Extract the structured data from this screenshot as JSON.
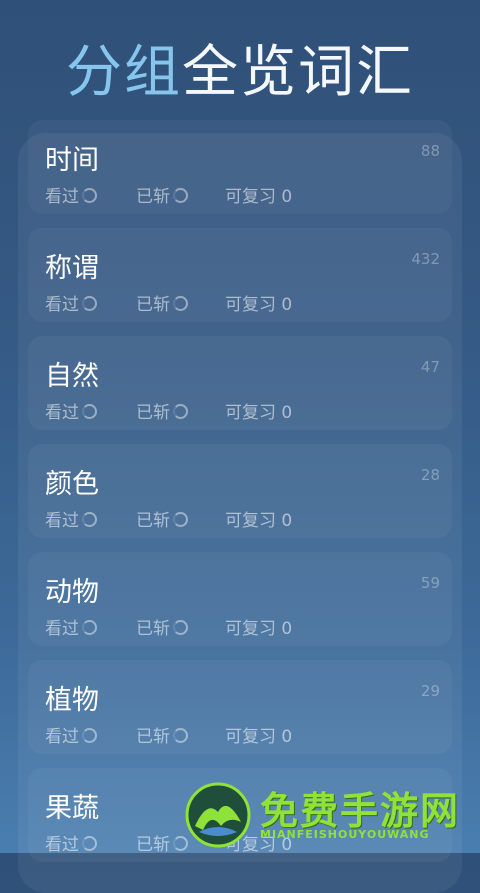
{
  "header": {
    "title_accent": "分组",
    "title_rest": "全览词汇"
  },
  "groups": [
    {
      "name": "时间",
      "count": "88",
      "seen_label": "看过",
      "cut_label": "已斩",
      "review_label": "可复习 0"
    },
    {
      "name": "称谓",
      "count": "432",
      "seen_label": "看过",
      "cut_label": "已斩",
      "review_label": "可复习 0"
    },
    {
      "name": "自然",
      "count": "47",
      "seen_label": "看过",
      "cut_label": "已斩",
      "review_label": "可复习 0"
    },
    {
      "name": "颜色",
      "count": "28",
      "seen_label": "看过",
      "cut_label": "已斩",
      "review_label": "可复习 0"
    },
    {
      "name": "动物",
      "count": "59",
      "seen_label": "看过",
      "cut_label": "已斩",
      "review_label": "可复习 0"
    },
    {
      "name": "植物",
      "count": "29",
      "seen_label": "看过",
      "cut_label": "已斩",
      "review_label": "可复习 0"
    },
    {
      "name": "果蔬",
      "count": "",
      "seen_label": "看过",
      "cut_label": "已斩",
      "review_label": "可复习 0"
    }
  ],
  "watermark": {
    "text": "免费手游网",
    "subtext": "MIANFEISHOUYOUWANG"
  },
  "colors": {
    "accent": "#86c6ee",
    "background_top": "#2f5078",
    "background_bottom": "#4a7eb0",
    "watermark_green": "#8fe23a"
  }
}
